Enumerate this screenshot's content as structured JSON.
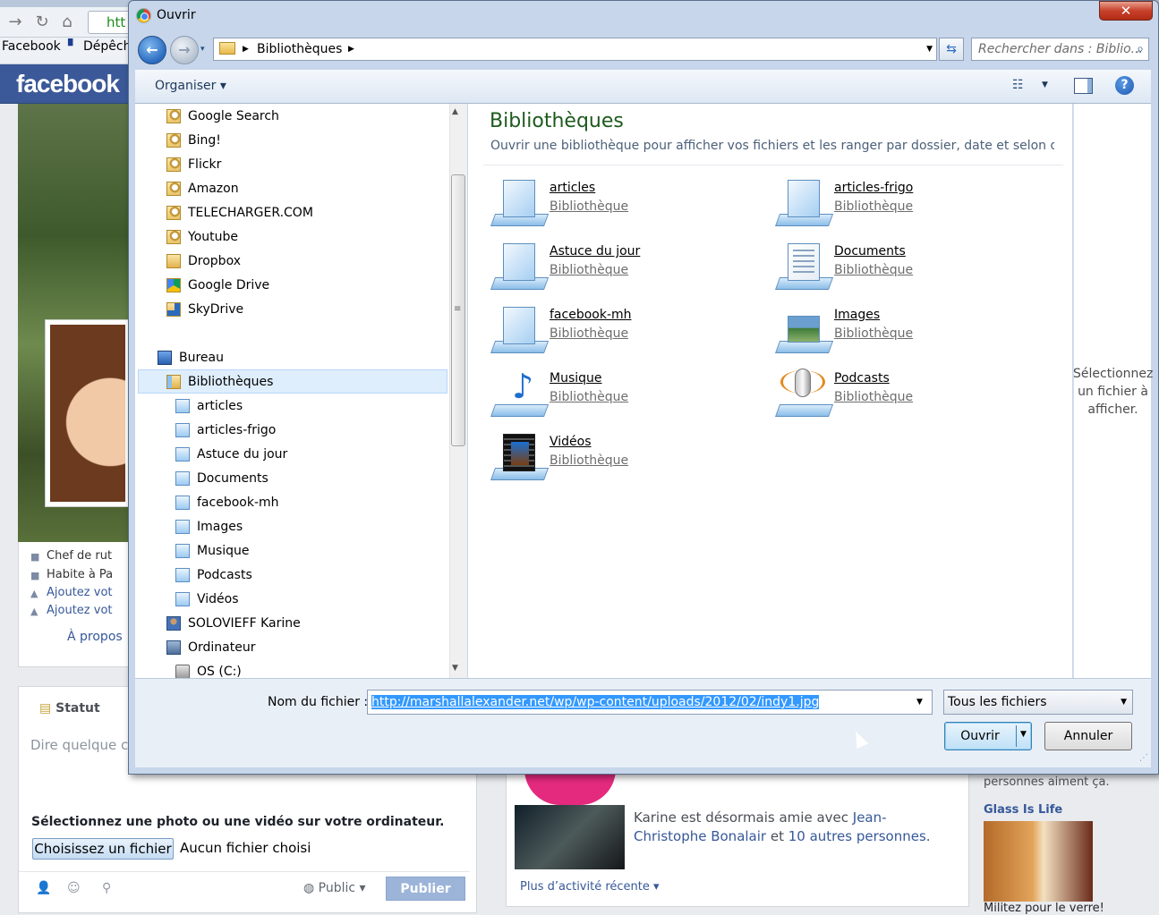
{
  "browser": {
    "url_fragment": "htt",
    "bookmarks": [
      "Facebook",
      "Dépêch"
    ]
  },
  "facebook": {
    "logo": "facebook",
    "info_lines": [
      "Chef de rut",
      "Habite à Pa",
      "Ajoutez vot",
      "Ajoutez vot"
    ],
    "about_link": "À propos",
    "status_tab": "Statut",
    "status_placeholder": "Dire quelque ch",
    "select_label": "Sélectionnez une photo ou une vidéo sur votre ordinateur.",
    "choose_file_button": "Choisissez un fichier",
    "no_file_text": "Aucun fichier choisi",
    "audience": "Public",
    "publish_button": "Publier",
    "feed_friend_prefix": "Karine est désormais amie avec ",
    "feed_friend_name": "Jean-Christophe Bonalair",
    "feed_friend_mid": " et ",
    "feed_friend_others": "10 autres personnes",
    "feed_friend_suffix": ".",
    "more_activity": "Plus d’activité récente ▾",
    "right_like_text": "personnes aiment ça.",
    "right_title": "Glass Is Life",
    "right_caption": "Militez pour le verre!"
  },
  "dialog": {
    "title": "Ouvrir",
    "close_glyph": "✕",
    "breadcrumb": "Bibliothèques",
    "search_placeholder": "Rechercher dans : Biblio...",
    "organize": "Organiser ▾",
    "nav_items": [
      {
        "label": "Google Search",
        "icon": "search-folder-icon"
      },
      {
        "label": "Bing!",
        "icon": "search-folder-icon"
      },
      {
        "label": "Flickr",
        "icon": "search-folder-icon"
      },
      {
        "label": "Amazon",
        "icon": "search-folder-icon"
      },
      {
        "label": "TELECHARGER.COM",
        "icon": "search-folder-icon"
      },
      {
        "label": "Youtube",
        "icon": "search-folder-icon"
      },
      {
        "label": "Dropbox",
        "icon": "folder-icon"
      },
      {
        "label": "Google Drive",
        "icon": "google-drive-icon"
      },
      {
        "label": "SkyDrive",
        "icon": "skydrive-icon"
      },
      {
        "label": "Bureau",
        "icon": "desktop-icon"
      },
      {
        "label": "Bibliothèques",
        "icon": "libraries-icon"
      },
      {
        "label": "articles",
        "icon": "library-icon"
      },
      {
        "label": "articles-frigo",
        "icon": "library-icon"
      },
      {
        "label": "Astuce du jour",
        "icon": "library-icon"
      },
      {
        "label": "Documents",
        "icon": "documents-library-icon"
      },
      {
        "label": "facebook-mh",
        "icon": "library-icon"
      },
      {
        "label": "Images",
        "icon": "pictures-library-icon"
      },
      {
        "label": "Musique",
        "icon": "music-library-icon"
      },
      {
        "label": "Podcasts",
        "icon": "podcasts-library-icon"
      },
      {
        "label": "Vidéos",
        "icon": "videos-library-icon"
      },
      {
        "label": "SOLOVIEFF Karine",
        "icon": "user-folder-icon"
      },
      {
        "label": "Ordinateur",
        "icon": "computer-icon"
      },
      {
        "label": "OS (C:)",
        "icon": "drive-icon"
      }
    ],
    "heading": "Bibliothèques",
    "subheading": "Ouvrir une bibliothèque pour afficher vos fichiers et les ranger par dossier, date et selon d’a...",
    "libraries": [
      {
        "name": "articles",
        "type": "Bibliothèque",
        "icon": "library-icon"
      },
      {
        "name": "articles-frigo",
        "type": "Bibliothèque",
        "icon": "library-icon"
      },
      {
        "name": "Astuce du jour",
        "type": "Bibliothèque",
        "icon": "library-icon"
      },
      {
        "name": "Documents",
        "type": "Bibliothèque",
        "icon": "documents-library-icon"
      },
      {
        "name": "facebook-mh",
        "type": "Bibliothèque",
        "icon": "library-icon"
      },
      {
        "name": "Images",
        "type": "Bibliothèque",
        "icon": "pictures-library-icon"
      },
      {
        "name": "Musique",
        "type": "Bibliothèque",
        "icon": "music-library-icon"
      },
      {
        "name": "Podcasts",
        "type": "Bibliothèque",
        "icon": "podcasts-library-icon"
      },
      {
        "name": "Vidéos",
        "type": "Bibliothèque",
        "icon": "videos-library-icon"
      }
    ],
    "preview_text": "Sélectionnez un fichier à afficher.",
    "filename_label": "Nom du fichier :",
    "filename_value": "http://marshallalexander.net/wp/wp-content/uploads/2012/02/indy1.jpg",
    "filter_value": "Tous les fichiers",
    "open_button": "Ouvrir",
    "cancel_button": "Annuler"
  }
}
